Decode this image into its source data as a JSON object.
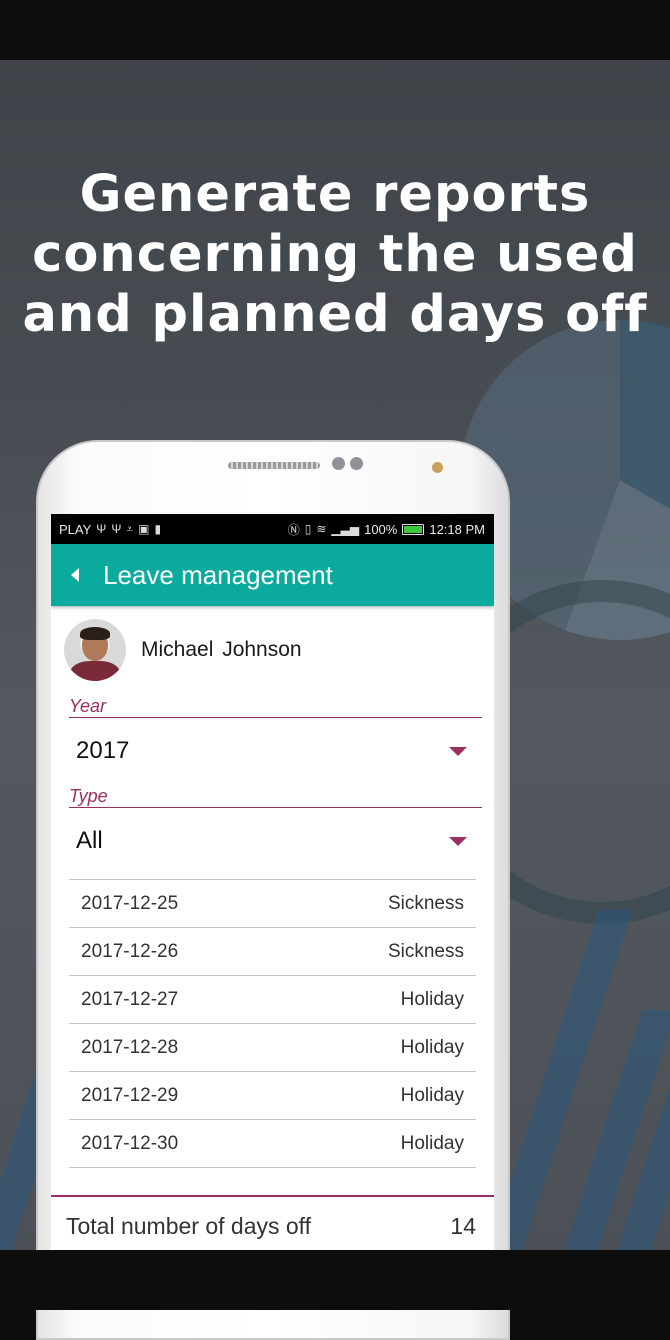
{
  "promo": {
    "headline_lines": [
      "Generate reports",
      "concerning the used",
      "and planned days off"
    ]
  },
  "status_bar": {
    "carrier": "PLAY",
    "left_icons": [
      "usb-icon",
      "usb-icon",
      "download-icon",
      "app-icon",
      "keyhole-icon"
    ],
    "right_icons": [
      "nfc-icon",
      "vibrate-icon",
      "wifi-icon",
      "signal-icon"
    ],
    "battery": "100%",
    "time": "12:18 PM"
  },
  "app_bar": {
    "title": "Leave management",
    "back_icon": "back-arrow-icon",
    "color": "#0aab9e"
  },
  "user": {
    "name": "Michael  Johnson"
  },
  "year_field": {
    "label": "Year",
    "value": "2017"
  },
  "type_field": {
    "label": "Type",
    "value": "All"
  },
  "leave_list": [
    {
      "date": "2017-12-25",
      "type": "Sickness"
    },
    {
      "date": "2017-12-26",
      "type": "Sickness"
    },
    {
      "date": "2017-12-27",
      "type": "Holiday"
    },
    {
      "date": "2017-12-28",
      "type": "Holiday"
    },
    {
      "date": "2017-12-29",
      "type": "Holiday"
    },
    {
      "date": "2017-12-30",
      "type": "Holiday"
    }
  ],
  "summary": {
    "label": "Total number of days off",
    "value": "14"
  },
  "colors": {
    "accent": "#9a2f62",
    "primary": "#0aab9e"
  }
}
